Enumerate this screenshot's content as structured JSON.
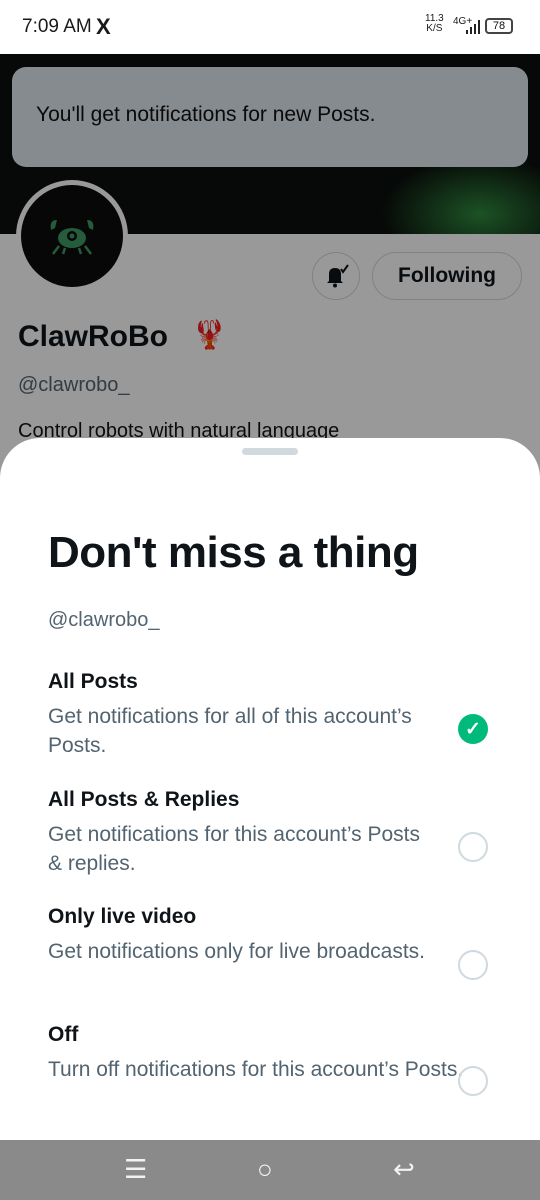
{
  "status_bar": {
    "time": "7:09 AM",
    "app_icon": "X",
    "net_speed": "11.3",
    "net_speed_unit": "K/S",
    "network": "4G+",
    "battery": "78"
  },
  "toast": {
    "message": "You'll get notifications for new Posts."
  },
  "profile": {
    "name": "ClawRoBo",
    "emoji": "🦞",
    "handle": "@clawrobo_",
    "bio": "Control robots with natural language",
    "following_label": "Following",
    "bell_icon": "bell-subscribed-icon"
  },
  "sheet": {
    "title": "Don't miss a thing",
    "handle": "@clawrobo_",
    "options": [
      {
        "title": "All Posts",
        "description": "Get notifications for all of this account’s Posts.",
        "selected": true
      },
      {
        "title": "All Posts & Replies",
        "description": "Get notifications for this account’s Posts & replies.",
        "selected": false
      },
      {
        "title": "Only live video",
        "description": "Get notifications only for live broadcasts.",
        "selected": false
      },
      {
        "title": "Off",
        "description": "Turn off notifications for this account’s Posts.",
        "selected": false
      }
    ]
  },
  "colors": {
    "accent_green": "#00ba7c",
    "text_primary": "#0f1419",
    "text_secondary": "#536471"
  },
  "nav_icons": [
    "menu-icon",
    "home-circle-icon",
    "back-icon"
  ]
}
